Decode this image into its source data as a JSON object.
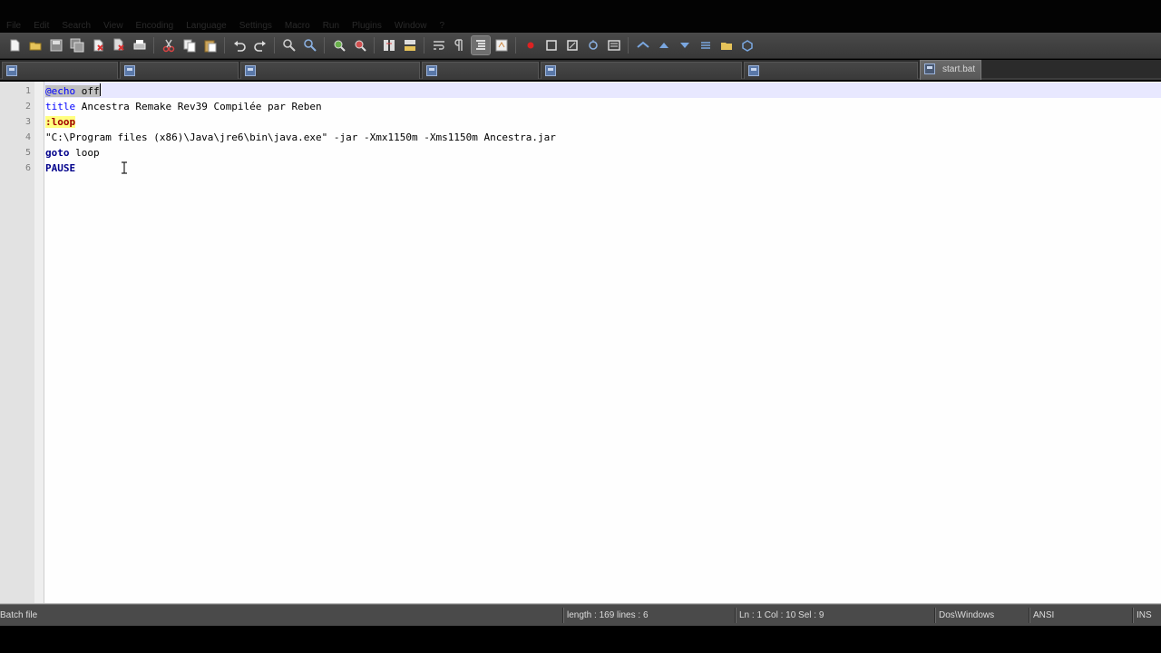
{
  "menu": {
    "items": [
      "File",
      "Edit",
      "Search",
      "View",
      "Encoding",
      "Language",
      "Settings",
      "Macro",
      "Run",
      "Plugins",
      "Window",
      "?"
    ]
  },
  "toolbar": {
    "buttons": [
      "new-file-icon",
      "open-file-icon",
      "save-icon",
      "save-all-icon",
      "close-icon",
      "close-all-icon",
      "print-icon",
      "cut-icon",
      "copy-icon",
      "paste-icon",
      "undo-icon",
      "redo-icon",
      "find-icon",
      "replace-icon",
      "zoom-in-icon",
      "zoom-out-icon",
      "sync-vertical-icon",
      "sync-horizontal-icon",
      "word-wrap-icon",
      "show-all-chars-icon",
      "indent-guide-icon",
      "user-language-icon",
      "record-macro-icon",
      "stop-macro-icon",
      "playback-macro-icon",
      "run-macro-multiple-icon",
      "save-macro-icon"
    ]
  },
  "tabs": [
    {
      "label": ""
    },
    {
      "label": ""
    },
    {
      "label": ""
    },
    {
      "label": ""
    },
    {
      "label": ""
    },
    {
      "label": ""
    },
    {
      "label": "start.bat"
    }
  ],
  "editor": {
    "line_numbers": [
      "1",
      "2",
      "3",
      "4",
      "5",
      "6"
    ],
    "lines": {
      "l1_sel_kw": "@echo",
      "l1_sel_rest": " off",
      "l2_kw": "title",
      "l2_rest": " Ancestra Remake Rev39 Compilée par Reben",
      "l3_label": ":loop",
      "l4_text": "\"C:\\Program files (x86)\\Java\\jre6\\bin\\java.exe\" -jar -Xmx1150m -Xms1150m Ancestra.jar",
      "l5_kw": "goto",
      "l5_rest": " loop",
      "l6_kw": "PAUSE"
    }
  },
  "status": {
    "file_type": "Batch file",
    "length_lines": "length : 169    lines : 6",
    "position": "Ln : 1    Col : 10    Sel : 9",
    "eol": "Dos\\Windows",
    "encoding": "ANSI",
    "mode": "INS"
  },
  "colors": {
    "keyword": "#0000ff",
    "keyword_bold": "#00008b",
    "label_bg": "#ffff80",
    "current_line": "#e8e8ff"
  }
}
